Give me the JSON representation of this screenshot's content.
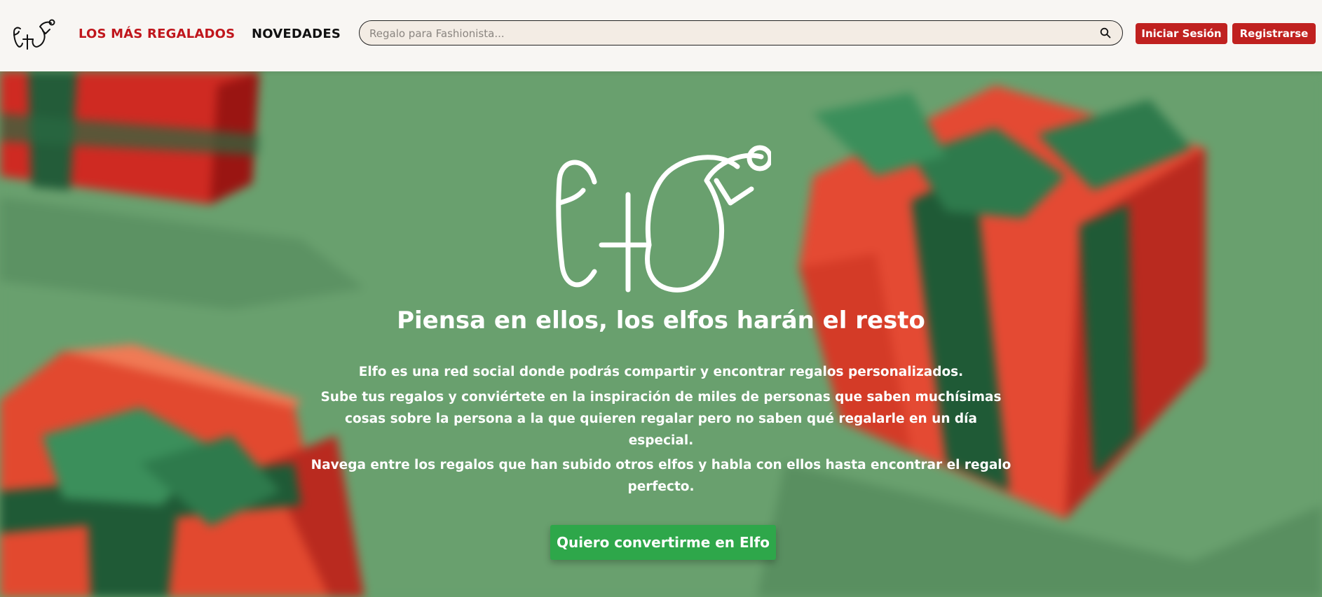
{
  "header": {
    "logo_text": "Elfo",
    "nav": {
      "top_gifted": "LOS MÁS REGALADOS",
      "new_items": "NOVEDADES"
    },
    "search": {
      "placeholder": "Regalo para Fashionista...",
      "value": "",
      "icon": "search-icon"
    },
    "login_label": "Iniciar Sesión",
    "register_label": "Registrarse"
  },
  "hero": {
    "logo_text": "Elfo",
    "title": "Piensa en ellos, los elfos harán el resto",
    "paragraphs": [
      "Elfo es una red social donde podrás compartir y encontrar regalos personalizados.",
      "Sube tus regalos y conviértete en la inspiración de miles de personas que saben muchísimas cosas sobre la persona a la que quieren regalar pero no saben qué regalarle en un día especial.",
      "Navega entre los regalos que han subido otros elfos y habla con ellos hasta encontrar el regalo perfecto."
    ],
    "cta_label": "Quiero convertirme en Elfo"
  },
  "colors": {
    "brand_red": "#c0211f",
    "nav_active_red": "#c0161c",
    "cta_green": "#2ea74a",
    "hero_bg_green": "#69a06e",
    "gift_red": "#e0432f",
    "ribbon_green": "#2e6b45"
  }
}
